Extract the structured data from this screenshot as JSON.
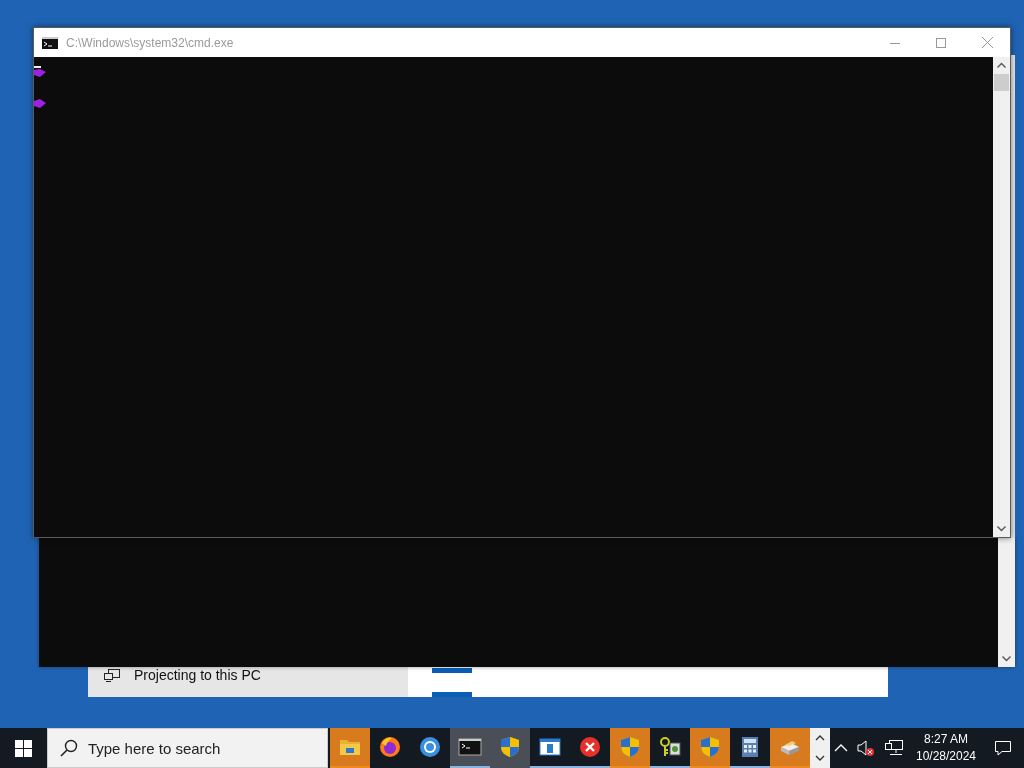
{
  "settings_window": {
    "sidebar_items": [
      {
        "label": "Projecting to this PC"
      }
    ]
  },
  "cmd_window": {
    "title": "C:\\Windows\\system32\\cmd.exe"
  },
  "taskbar": {
    "search": {
      "placeholder": "Type here to search"
    },
    "apps": [
      {
        "kind": "folder",
        "flashing": true,
        "active": false,
        "running": false
      },
      {
        "kind": "fox",
        "flashing": false,
        "active": false,
        "running": false
      },
      {
        "kind": "ring",
        "flashing": false,
        "active": false,
        "running": false
      },
      {
        "kind": "terminal",
        "flashing": false,
        "active": true,
        "running": true
      },
      {
        "kind": "shield",
        "flashing": false,
        "active": true,
        "running": false
      },
      {
        "kind": "panel",
        "flashing": false,
        "active": false,
        "running": true
      },
      {
        "kind": "error",
        "flashing": false,
        "active": false,
        "running": true
      },
      {
        "kind": "shield",
        "flashing": true,
        "active": false,
        "running": false
      },
      {
        "kind": "keys",
        "flashing": false,
        "active": false,
        "running": true
      },
      {
        "kind": "shield",
        "flashing": true,
        "active": false,
        "running": false
      },
      {
        "kind": "calculator",
        "flashing": false,
        "active": false,
        "running": true
      },
      {
        "kind": "printer",
        "flashing": true,
        "active": false,
        "running": false
      }
    ],
    "clock": {
      "time": "8:27 AM",
      "date": "10/28/2024"
    }
  }
}
